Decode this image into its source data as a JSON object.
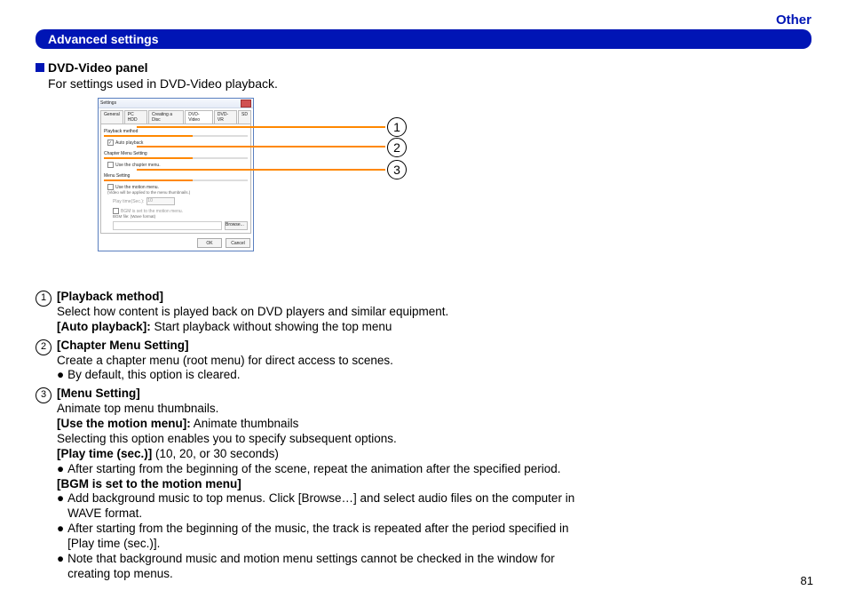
{
  "header": {
    "category": "Other",
    "title": "Advanced settings"
  },
  "section": {
    "heading": "DVD-Video panel",
    "desc": "For settings used in DVD-Video playback."
  },
  "dialog": {
    "title": "Settings",
    "tabs": [
      "General",
      "PC HDD",
      "Creating a Disc",
      "DVD-Video",
      "DVD-VR",
      "SD"
    ],
    "active_tab_index": 3,
    "sec1": {
      "label": "Playback method",
      "checkbox": "Auto playback"
    },
    "sec2": {
      "label": "Chapter Menu Setting",
      "checkbox": "Use the chapter menu."
    },
    "sec3": {
      "label": "Menu Setting",
      "checkbox": "Use the motion menu.",
      "note": "(Video will be applied to the menu thumbnails.)",
      "playtime_label": "Play time(Sec.):",
      "playtime_value": "10",
      "bgm": "BGM is set to the motion menu.",
      "bgm_file": "BGM file: (Wave format)",
      "browse": "Browse..."
    },
    "ok": "OK",
    "cancel": "Cancel"
  },
  "callouts": {
    "c1": "1",
    "c2": "2",
    "c3": "3"
  },
  "items": {
    "i1": {
      "num": "1",
      "title": "[Playback method]",
      "desc": "Select how content is played back on DVD players and similar equipment.",
      "opt_b": "[Auto playback]:",
      "opt_t": " Start playback without showing the top menu"
    },
    "i2": {
      "num": "2",
      "title": "[Chapter Menu Setting]",
      "desc": "Create a chapter menu (root menu) for direct access to scenes.",
      "bullet": "By default, this option is cleared."
    },
    "i3": {
      "num": "3",
      "title": "[Menu Setting]",
      "l1": "Animate top menu thumbnails.",
      "use_b": "[Use the motion menu]:",
      "use_t": " Animate thumbnails",
      "l2": "Selecting this option enables you to specify subsequent options.",
      "pt_b": "[Play time (sec.)]",
      "pt_t": " (10, 20, or 30 seconds)",
      "pt_bullet": "After starting from the beginning of the scene, repeat the animation after the specified period.",
      "bgm_b": "[BGM is set to the motion menu]",
      "bgm_b1": "Add background music to top menus. Click [Browse…] and select audio files on the computer in WAVE format.",
      "bgm_b2": "After starting from the beginning of the music, the track is repeated after the period specified in [Play time (sec.)].",
      "bgm_b3": "Note that background music and motion menu settings cannot be checked in the window for creating top menus."
    }
  },
  "page_number": "81"
}
